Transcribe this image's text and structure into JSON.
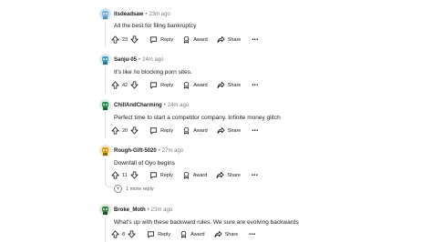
{
  "comments": [
    {
      "username": "itsdeadsaw",
      "time": "23m ago",
      "body": "All the best for filing bankruptcy",
      "score": "23",
      "reply": "Reply",
      "award": "Award",
      "share": "Share",
      "avatar_color": "#7fb3d5"
    },
    {
      "username": "Sanju-05",
      "time": "24m ago",
      "body": "It's like /io blocking porn sites.",
      "score": "42",
      "reply": "Reply",
      "award": "Award",
      "share": "Share",
      "avatar_color": "#4a9fb5"
    },
    {
      "username": "ChillAndCharming",
      "time": "24m ago",
      "body": "Perfect time to start a competitor company. Infinite money glitch",
      "score": "20",
      "reply": "Reply",
      "award": "Award",
      "share": "Share",
      "avatar_color": "#2e8b57"
    },
    {
      "username": "Rough-Gift-5020",
      "time": "27m ago",
      "body": "Downfall of Oyo begins",
      "score": "11",
      "reply": "Reply",
      "award": "Award",
      "share": "Share",
      "avatar_color": "#d4a017",
      "more_replies": "1 more reply"
    },
    {
      "username": "Broke_Moth",
      "time": "23m ago",
      "body": "What's up with these backward rules. We sure are evolving backwards",
      "score": "8",
      "reply": "Reply",
      "award": "Award",
      "share": "Share",
      "avatar_color": "#3a7d44"
    }
  ]
}
